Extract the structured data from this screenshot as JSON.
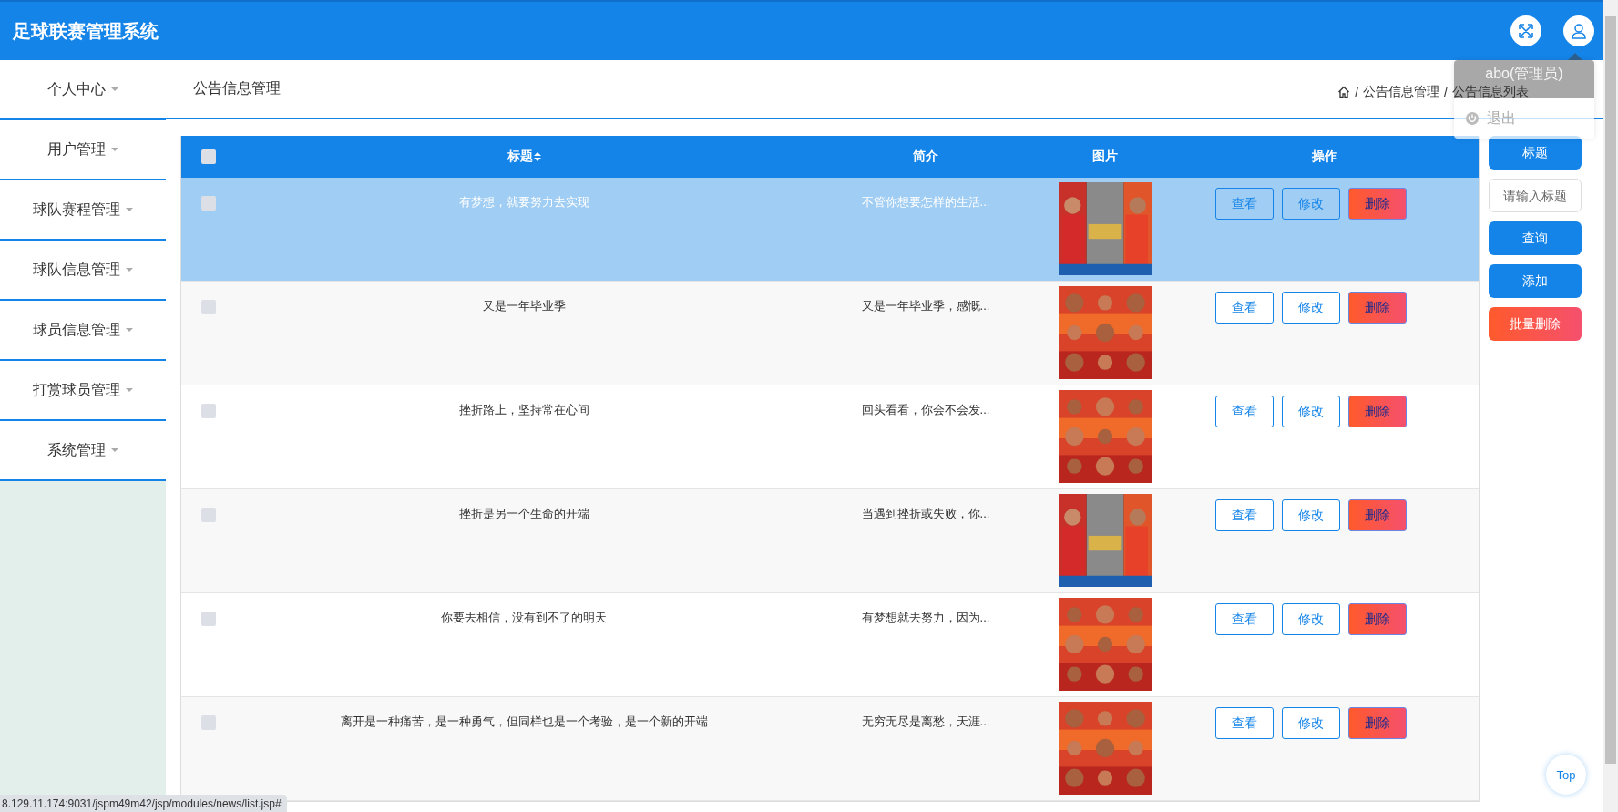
{
  "header": {
    "title": "足球联赛管理系统"
  },
  "user_menu": {
    "user": "abo(管理员)",
    "items": [
      "退出"
    ]
  },
  "sidebar": {
    "items": [
      {
        "label": "个人中心"
      },
      {
        "label": "用户管理"
      },
      {
        "label": "球队赛程管理"
      },
      {
        "label": "球队信息管理"
      },
      {
        "label": "球员信息管理"
      },
      {
        "label": "打赏球员管理"
      },
      {
        "label": "系统管理"
      }
    ]
  },
  "page_title": "公告信息管理",
  "breadcrumb": {
    "separator": "/",
    "items": [
      "公告信息管理",
      "公告信息列表"
    ]
  },
  "table": {
    "select_all_checked": false,
    "columns": [
      "标题",
      "简介",
      "图片",
      "操作"
    ],
    "rows": [
      {
        "title": "有梦想，就要努力去实现",
        "summary": "不管你想要怎样的生活...",
        "picture": {
          "kind": "picture"
        },
        "actions": [
          "查看",
          "修改",
          "删除"
        ],
        "checked": false,
        "selected": true
      },
      {
        "title": "又是一年毕业季",
        "summary": "又是一年毕业季，感慨...",
        "picture": {
          "kind": "picture"
        },
        "actions": [
          "查看",
          "修改",
          "删除"
        ],
        "checked": false,
        "selected": false
      },
      {
        "title": "挫折路上，坚持常在心间",
        "summary": "回头看看，你会不会发...",
        "picture": {
          "kind": "picture"
        },
        "actions": [
          "查看",
          "修改",
          "删除"
        ],
        "checked": false,
        "selected": false
      },
      {
        "title": "挫折是另一个生命的开端",
        "summary": "当遇到挫折或失败，你...",
        "picture": {
          "kind": "picture"
        },
        "actions": [
          "查看",
          "修改",
          "删除"
        ],
        "checked": false,
        "selected": false
      },
      {
        "title": "你要去相信，没有到不了的明天",
        "summary": "有梦想就去努力，因为...",
        "picture": {
          "kind": "picture"
        },
        "actions": [
          "查看",
          "修改",
          "删除"
        ],
        "checked": false,
        "selected": false
      },
      {
        "title": "离开是一种痛苦，是一种勇气，但同样也是一个考验，是一个新的开端",
        "summary": "无穷无尽是离愁，天涯...",
        "picture": {
          "kind": "picture"
        },
        "actions": [
          "查看",
          "修改",
          "删除"
        ],
        "checked": false,
        "selected": false
      }
    ]
  },
  "search_panel": {
    "label": "标题",
    "placeholder": "请输入标题",
    "buttons": [
      {
        "label": "查询",
        "kind": "primary"
      },
      {
        "label": "添加",
        "kind": "primary"
      },
      {
        "label": "批量删除",
        "kind": "danger"
      }
    ]
  },
  "status_url": "8.129.11.174:9031/jspm49m42/jsp/modules/news/list.jsp#",
  "back_to_top": "Top"
}
